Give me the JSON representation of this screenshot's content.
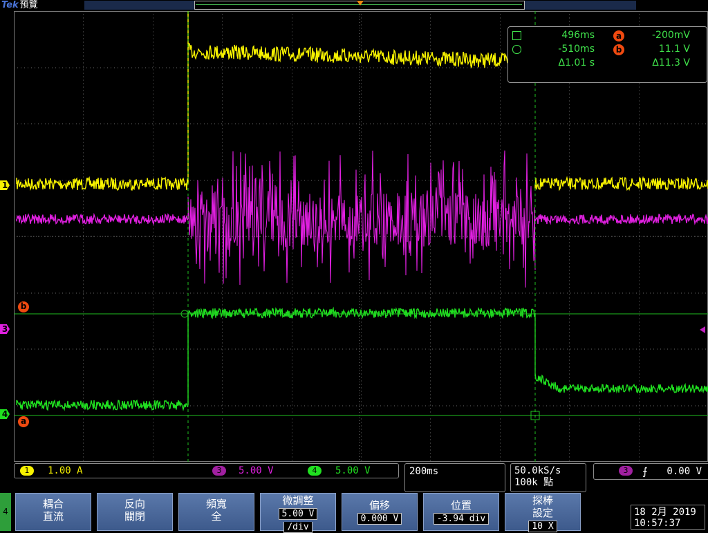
{
  "brand": {
    "logo": "Tek",
    "mode": "預覽"
  },
  "channels": [
    {
      "num": "1",
      "scale": "1.00 A",
      "color": "#f7f200"
    },
    {
      "num": "3",
      "scale": "5.00 V",
      "color": "#e020e0"
    },
    {
      "num": "4",
      "scale": "5.00 V",
      "color": "#20e020"
    }
  ],
  "timebase": {
    "scale": "200ms"
  },
  "acquisition": {
    "sample_rate": "50.0kS/s",
    "record_length": "100k 點"
  },
  "trigger": {
    "source": "3",
    "slope_icon": "rising-edge-icon",
    "level": "0.00 V"
  },
  "readout": {
    "row1": {
      "time": "496ms",
      "cursor": "a",
      "value": "-200mV"
    },
    "row2": {
      "time": "-510ms",
      "cursor": "b",
      "value": "11.1 V"
    },
    "row3": {
      "dtime": "Δ1.01 s",
      "dvalue": "Δ11.3 V"
    }
  },
  "markers": {
    "ch1": "1",
    "cursor_b": "b",
    "ch3": "3",
    "ch4": "4",
    "cursor_a": "a"
  },
  "menu": {
    "tab": "4",
    "buttons": [
      {
        "top": "耦合",
        "bottom": "直流"
      },
      {
        "top": "反向",
        "bottom": "關閉"
      },
      {
        "top": "頻寬",
        "bottom": "全"
      },
      {
        "top": "微調整",
        "value": "5.00 V",
        "bottom": "/div"
      },
      {
        "top": "偏移",
        "value": "0.000 V"
      },
      {
        "top": "位置",
        "value": "-3.94 div"
      },
      {
        "top": "探棒",
        "mid": "設定",
        "value": "10 X"
      }
    ]
  },
  "datetime": {
    "date": "18 2月 2019",
    "time": "10:57:37"
  },
  "colors": {
    "ch1": "#f7f200",
    "ch3": "#e020e0",
    "ch4": "#20e020",
    "cursor": "#f04a10",
    "menu": "#4a68a0"
  }
}
